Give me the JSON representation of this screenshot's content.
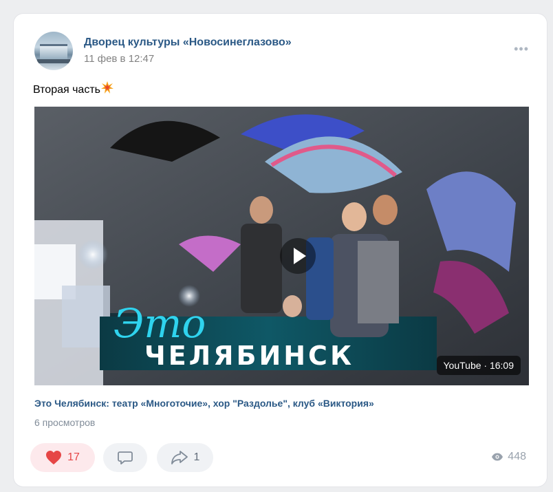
{
  "post": {
    "author": "Дворец культуры «Новосинеглазово»",
    "date": "11 фев в 12:47",
    "more_label": "•••",
    "text": "Вторая часть",
    "emoji_icon": "collision-emoji-icon"
  },
  "video": {
    "overlay_word_1": "Это",
    "overlay_word_2": "ЧЕЛЯБИНСК",
    "badge": "YouTube · 16:09",
    "title": "Это Челябинск: театр «Многоточие», хор \"Раздолье\", клуб «Виктория»",
    "views": "6 просмотров"
  },
  "actions": {
    "likes": "17",
    "shares": "1",
    "view_count": "448",
    "like_color": "#e64646"
  }
}
